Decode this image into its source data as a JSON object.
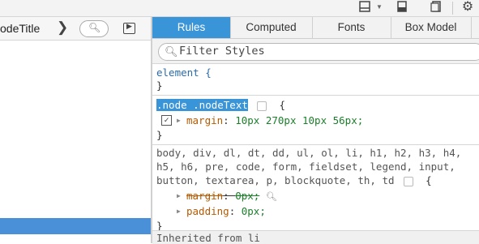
{
  "breadcrumb": {
    "label": "odeTitle"
  },
  "tabs": [
    "Rules",
    "Computed",
    "Fonts",
    "Box Model"
  ],
  "filter": {
    "placeholder": "Filter Styles"
  },
  "rules": {
    "element": {
      "selector": "element {",
      "close": "}"
    },
    "nodeText": {
      "selector": ".node .nodeText",
      "open": "{",
      "prop": "margin",
      "value": "10px 270px 10px 56px;",
      "close": "}"
    },
    "ua": {
      "selector_line1": "body, div, dl, dt, dd, ul, ol, li, h1, h2, h3, h4,",
      "selector_line2": "h5, h6, pre, code, form, fieldset, legend, input,",
      "selector_line3": "button, textarea, p, blockquote, th, td",
      "open": "{",
      "prop1": "margin",
      "value1": "0px;",
      "prop2": "padding",
      "value2": "0px;",
      "close": "}"
    }
  },
  "inherited": {
    "label": "Inherited from li"
  },
  "icons": {
    "layout": "layout-icon",
    "dock": "dock-icon",
    "pages": "pages-icon",
    "settings": "gear-icon",
    "chevron": "chevron-right-icon",
    "search": "search-icon",
    "panel": "panel-toggle-icon"
  }
}
